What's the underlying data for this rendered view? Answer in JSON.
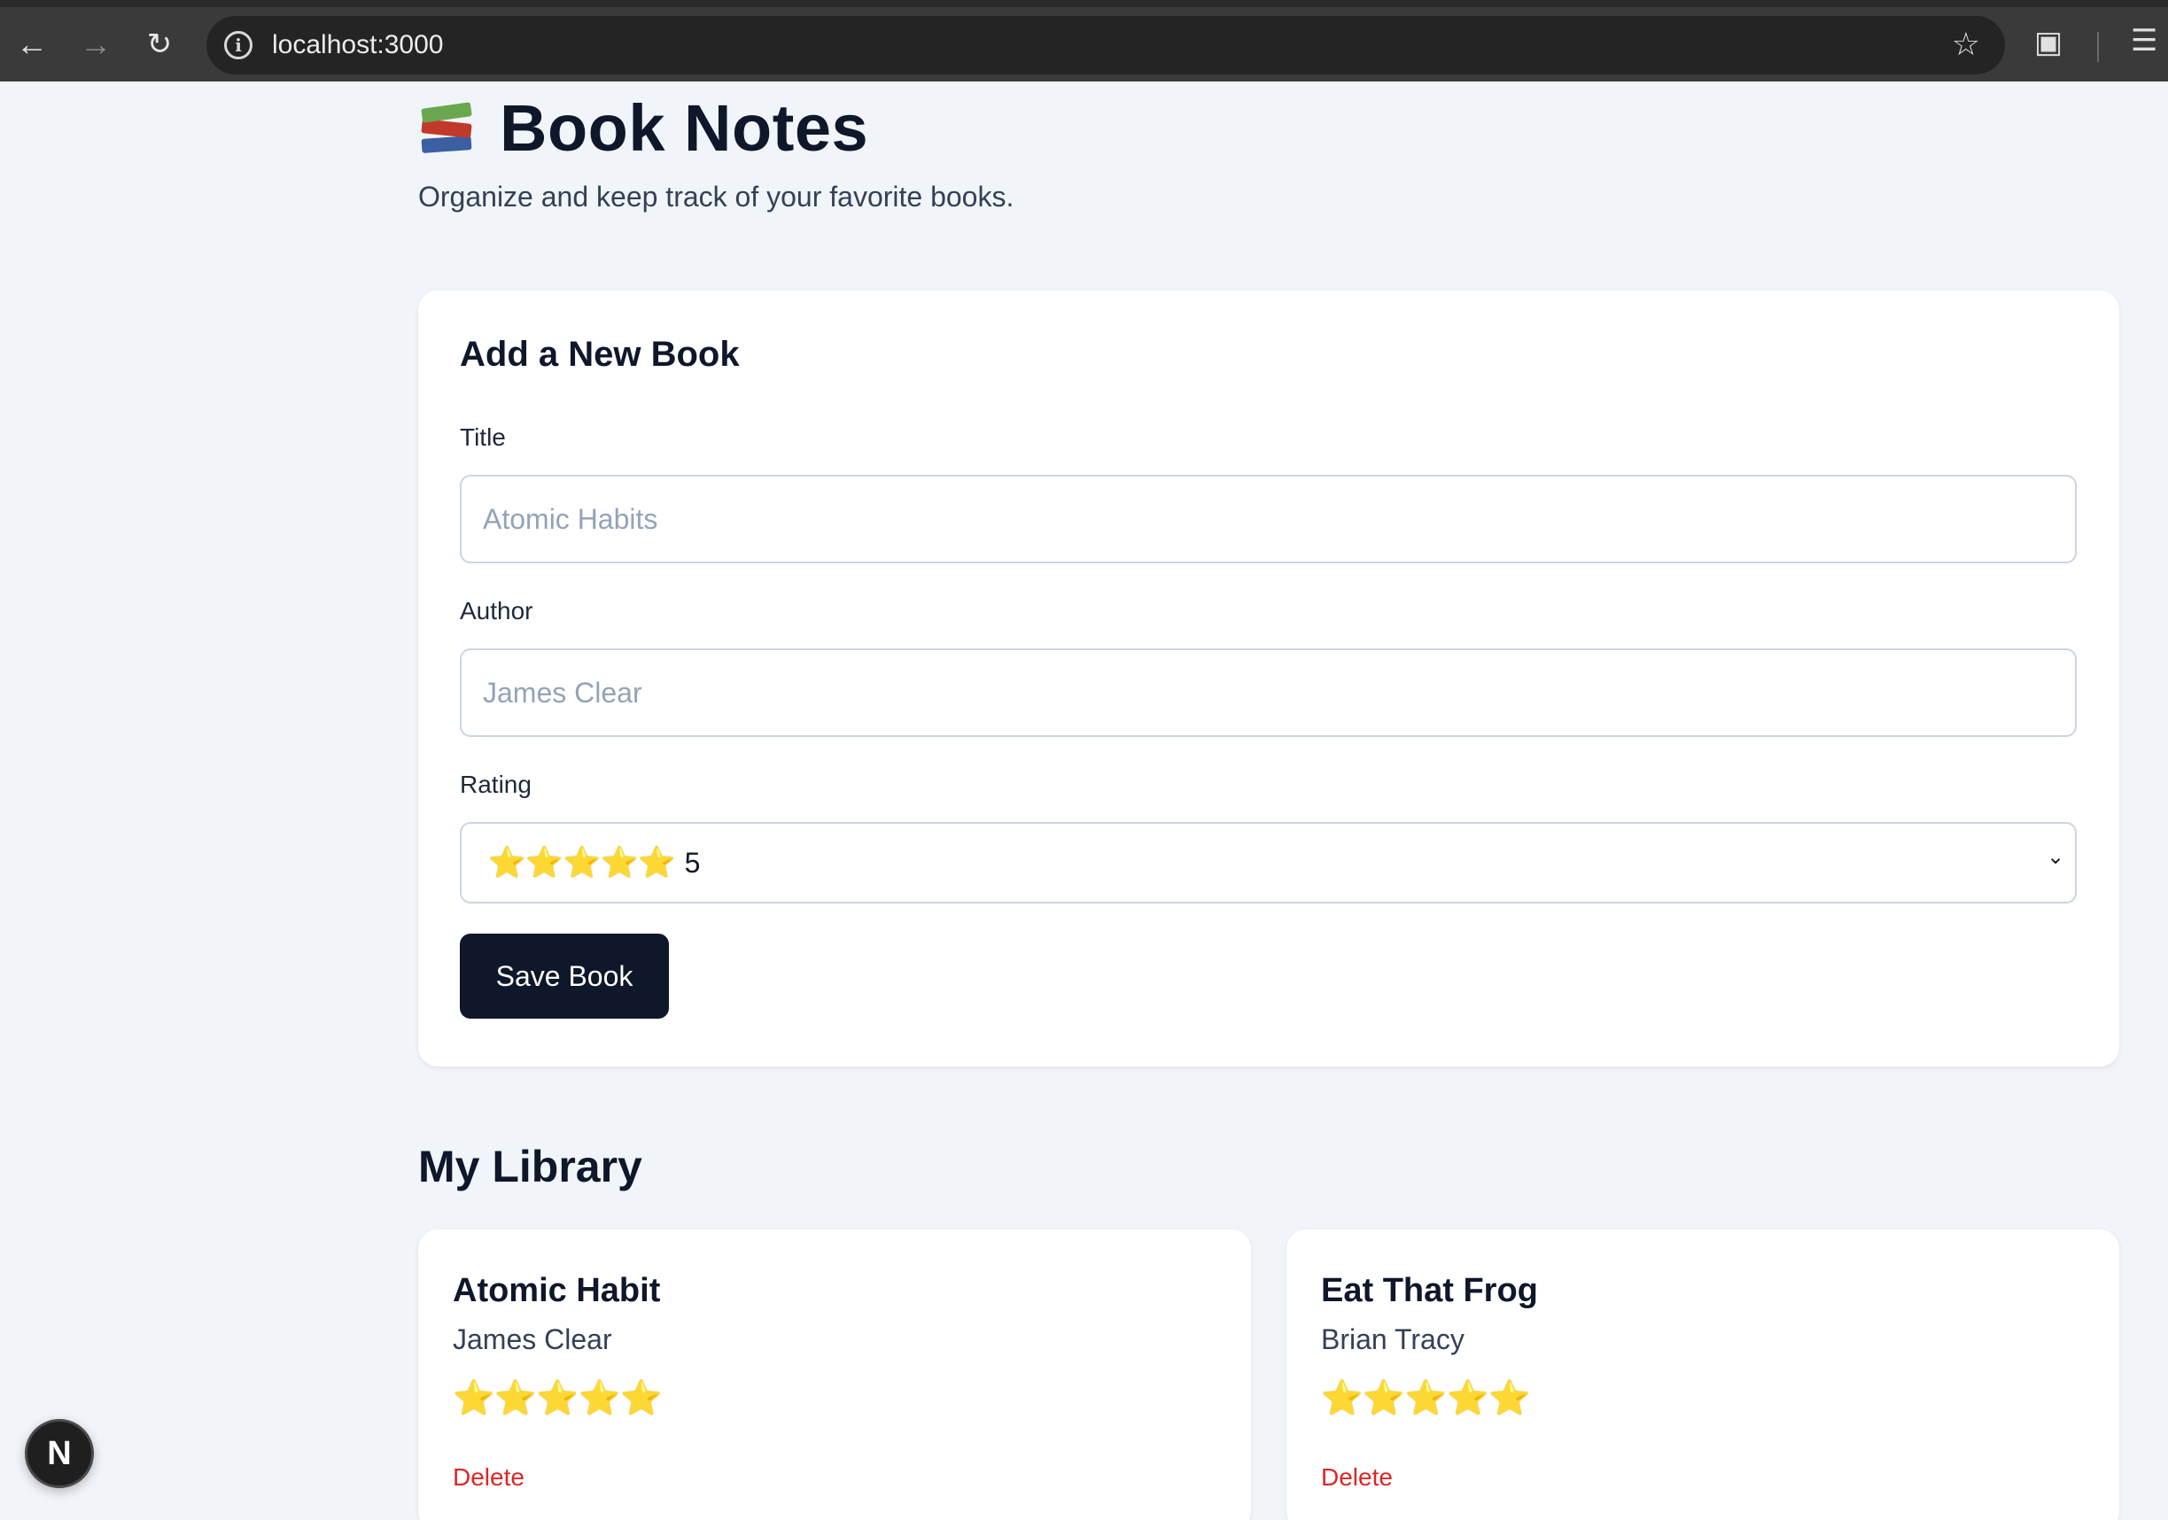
{
  "browser": {
    "url": "localhost:3000",
    "icons": {
      "back": "arrow-left",
      "forward": "arrow-right",
      "reload": "reload",
      "info": "info",
      "bookmark": "star",
      "extensions": "puzzle",
      "media": "playlist"
    }
  },
  "header": {
    "title": "Book Notes",
    "subtitle": "Organize and keep track of your favorite books."
  },
  "form": {
    "heading": "Add a New Book",
    "title_label": "Title",
    "title_placeholder": "Atomic Habits",
    "author_label": "Author",
    "author_placeholder": "James Clear",
    "rating_label": "Rating",
    "rating_stars": "⭐⭐⭐⭐⭐",
    "rating_value": "5",
    "save_label": "Save Book"
  },
  "library": {
    "heading": "My Library",
    "books": [
      {
        "title": "Atomic Habit",
        "author": "James Clear",
        "rating": 5,
        "delete_label": "Delete"
      },
      {
        "title": "Eat That Frog",
        "author": "Brian Tracy",
        "rating": 5,
        "delete_label": "Delete"
      }
    ]
  },
  "devtools_badge": "N",
  "colors": {
    "primary": "#0f172a",
    "background": "#f1f5f9",
    "danger": "#dc2626",
    "star": "#f5b800"
  }
}
